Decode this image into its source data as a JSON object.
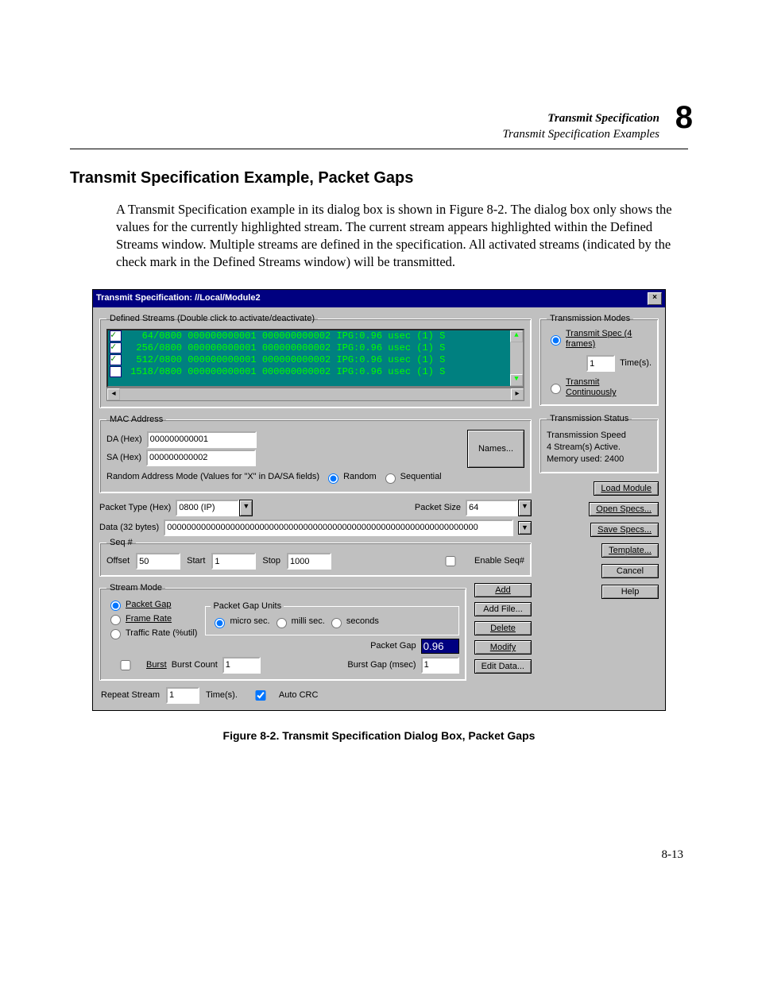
{
  "header": {
    "line1": "Transmit Specification",
    "line2": "Transmit Specification Examples",
    "chapnum": "8"
  },
  "section_title": "Transmit Specification Example, Packet Gaps",
  "paragraph": "A Transmit Specification example in its dialog box is shown in Figure 8-2. The dialog box only shows the values for the currently highlighted stream. The current stream appears highlighted within the Defined Streams window. Multiple streams are defined in the specification. All activated streams (indicated by the check mark in the Defined Streams window) will be transmitted.",
  "figure_caption": "Figure 8-2.  Transmit Specification Dialog Box, Packet Gaps",
  "page_number": "8-13",
  "dialog": {
    "title": "Transmit Specification: //Local/Module2",
    "close": "×",
    "defined_streams_legend": "Defined Streams (Double click to activate/deactivate)",
    "streams": [
      "   64/0800 000000000001 000000000002 IPG:0.96 usec (1) S",
      "  256/0800 000000000001 000000000002 IPG:0.96 usec (1) S",
      "  512/0800 000000000001 000000000002 IPG:0.96 usec (1) S",
      " 1518/0800 000000000001 000000000002 IPG:0.96 usec (1) S"
    ],
    "mac": {
      "legend": "MAC Address",
      "da_label": "DA (Hex)",
      "da_value": "000000000001",
      "sa_label": "SA (Hex)",
      "sa_value": "000000000002",
      "names_btn": "Names...",
      "random_label": "Random Address Mode (Values for \"X\" in DA/SA fields)",
      "random_opt": "Random",
      "sequential_opt": "Sequential"
    },
    "packet_type_label": "Packet Type (Hex)",
    "packet_type_value": "0800 (IP)",
    "packet_size_label": "Packet Size",
    "packet_size_value": "64",
    "data_label": "Data (32 bytes)",
    "data_value": "0000000000000000000000000000000000000000000000000000000000000000",
    "seq": {
      "legend": "Seq #",
      "offset_label": "Offset",
      "offset_value": "50",
      "start_label": "Start",
      "start_value": "1",
      "stop_label": "Stop",
      "stop_value": "1000",
      "enable_label": "Enable Seq#"
    },
    "buttons": {
      "add": "Add",
      "add_file": "Add File...",
      "delete": "Delete",
      "modify": "Modify",
      "edit_data": "Edit Data..."
    },
    "stream_mode": {
      "legend": "Stream Mode",
      "packet_gap": "Packet Gap",
      "frame_rate": "Frame Rate",
      "traffic_rate": "Traffic Rate (%util)",
      "gap_units_legend": "Packet Gap Units",
      "units_usec": "micro sec.",
      "units_msec": "milli sec.",
      "units_sec": "seconds",
      "packet_gap_label": "Packet Gap",
      "packet_gap_value": "0.96",
      "burst_label": "Burst",
      "burst_count_label": "Burst Count",
      "burst_count_value": "1",
      "burst_gap_label": "Burst Gap (msec)",
      "burst_gap_value": "1"
    },
    "repeat": {
      "label": "Repeat Stream",
      "value": "1",
      "times": "Time(s).",
      "auto_crc": "Auto CRC"
    },
    "trans_modes": {
      "legend": "Transmission Modes",
      "spec": "Transmit Spec (4 frames)",
      "times_value": "1",
      "times_unit": "Time(s).",
      "cont": "Transmit Continuously"
    },
    "trans_status": {
      "legend": "Transmission Status",
      "speed": "Transmission Speed",
      "active": "4 Stream(s) Active.",
      "memory": "Memory used: 2400"
    },
    "side_buttons": {
      "load": "Load Module",
      "open": "Open Specs...",
      "save": "Save Specs...",
      "template": "Template...",
      "cancel": "Cancel",
      "help": "Help"
    }
  }
}
